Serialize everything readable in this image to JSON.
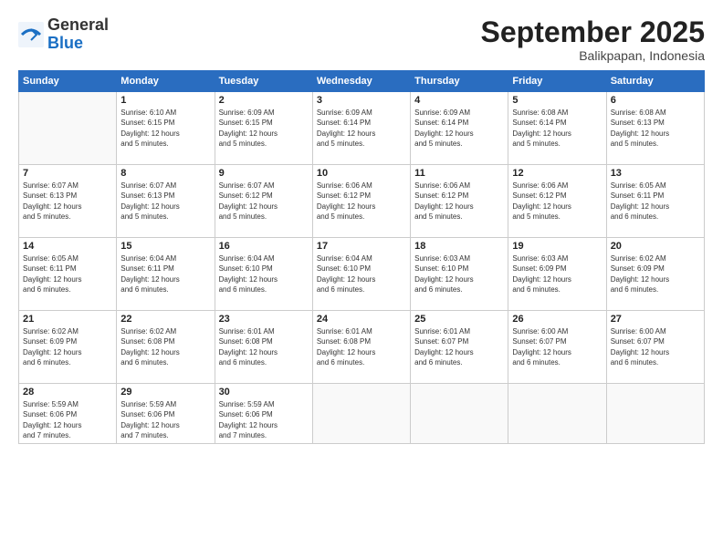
{
  "logo": {
    "general": "General",
    "blue": "Blue"
  },
  "title": "September 2025",
  "subtitle": "Balikpapan, Indonesia",
  "headers": [
    "Sunday",
    "Monday",
    "Tuesday",
    "Wednesday",
    "Thursday",
    "Friday",
    "Saturday"
  ],
  "weeks": [
    [
      {
        "day": "",
        "info": ""
      },
      {
        "day": "1",
        "info": "Sunrise: 6:10 AM\nSunset: 6:15 PM\nDaylight: 12 hours\nand 5 minutes."
      },
      {
        "day": "2",
        "info": "Sunrise: 6:09 AM\nSunset: 6:15 PM\nDaylight: 12 hours\nand 5 minutes."
      },
      {
        "day": "3",
        "info": "Sunrise: 6:09 AM\nSunset: 6:14 PM\nDaylight: 12 hours\nand 5 minutes."
      },
      {
        "day": "4",
        "info": "Sunrise: 6:09 AM\nSunset: 6:14 PM\nDaylight: 12 hours\nand 5 minutes."
      },
      {
        "day": "5",
        "info": "Sunrise: 6:08 AM\nSunset: 6:14 PM\nDaylight: 12 hours\nand 5 minutes."
      },
      {
        "day": "6",
        "info": "Sunrise: 6:08 AM\nSunset: 6:13 PM\nDaylight: 12 hours\nand 5 minutes."
      }
    ],
    [
      {
        "day": "7",
        "info": "Sunrise: 6:07 AM\nSunset: 6:13 PM\nDaylight: 12 hours\nand 5 minutes."
      },
      {
        "day": "8",
        "info": "Sunrise: 6:07 AM\nSunset: 6:13 PM\nDaylight: 12 hours\nand 5 minutes."
      },
      {
        "day": "9",
        "info": "Sunrise: 6:07 AM\nSunset: 6:12 PM\nDaylight: 12 hours\nand 5 minutes."
      },
      {
        "day": "10",
        "info": "Sunrise: 6:06 AM\nSunset: 6:12 PM\nDaylight: 12 hours\nand 5 minutes."
      },
      {
        "day": "11",
        "info": "Sunrise: 6:06 AM\nSunset: 6:12 PM\nDaylight: 12 hours\nand 5 minutes."
      },
      {
        "day": "12",
        "info": "Sunrise: 6:06 AM\nSunset: 6:12 PM\nDaylight: 12 hours\nand 5 minutes."
      },
      {
        "day": "13",
        "info": "Sunrise: 6:05 AM\nSunset: 6:11 PM\nDaylight: 12 hours\nand 6 minutes."
      }
    ],
    [
      {
        "day": "14",
        "info": "Sunrise: 6:05 AM\nSunset: 6:11 PM\nDaylight: 12 hours\nand 6 minutes."
      },
      {
        "day": "15",
        "info": "Sunrise: 6:04 AM\nSunset: 6:11 PM\nDaylight: 12 hours\nand 6 minutes."
      },
      {
        "day": "16",
        "info": "Sunrise: 6:04 AM\nSunset: 6:10 PM\nDaylight: 12 hours\nand 6 minutes."
      },
      {
        "day": "17",
        "info": "Sunrise: 6:04 AM\nSunset: 6:10 PM\nDaylight: 12 hours\nand 6 minutes."
      },
      {
        "day": "18",
        "info": "Sunrise: 6:03 AM\nSunset: 6:10 PM\nDaylight: 12 hours\nand 6 minutes."
      },
      {
        "day": "19",
        "info": "Sunrise: 6:03 AM\nSunset: 6:09 PM\nDaylight: 12 hours\nand 6 minutes."
      },
      {
        "day": "20",
        "info": "Sunrise: 6:02 AM\nSunset: 6:09 PM\nDaylight: 12 hours\nand 6 minutes."
      }
    ],
    [
      {
        "day": "21",
        "info": "Sunrise: 6:02 AM\nSunset: 6:09 PM\nDaylight: 12 hours\nand 6 minutes."
      },
      {
        "day": "22",
        "info": "Sunrise: 6:02 AM\nSunset: 6:08 PM\nDaylight: 12 hours\nand 6 minutes."
      },
      {
        "day": "23",
        "info": "Sunrise: 6:01 AM\nSunset: 6:08 PM\nDaylight: 12 hours\nand 6 minutes."
      },
      {
        "day": "24",
        "info": "Sunrise: 6:01 AM\nSunset: 6:08 PM\nDaylight: 12 hours\nand 6 minutes."
      },
      {
        "day": "25",
        "info": "Sunrise: 6:01 AM\nSunset: 6:07 PM\nDaylight: 12 hours\nand 6 minutes."
      },
      {
        "day": "26",
        "info": "Sunrise: 6:00 AM\nSunset: 6:07 PM\nDaylight: 12 hours\nand 6 minutes."
      },
      {
        "day": "27",
        "info": "Sunrise: 6:00 AM\nSunset: 6:07 PM\nDaylight: 12 hours\nand 6 minutes."
      }
    ],
    [
      {
        "day": "28",
        "info": "Sunrise: 5:59 AM\nSunset: 6:06 PM\nDaylight: 12 hours\nand 7 minutes."
      },
      {
        "day": "29",
        "info": "Sunrise: 5:59 AM\nSunset: 6:06 PM\nDaylight: 12 hours\nand 7 minutes."
      },
      {
        "day": "30",
        "info": "Sunrise: 5:59 AM\nSunset: 6:06 PM\nDaylight: 12 hours\nand 7 minutes."
      },
      {
        "day": "",
        "info": ""
      },
      {
        "day": "",
        "info": ""
      },
      {
        "day": "",
        "info": ""
      },
      {
        "day": "",
        "info": ""
      }
    ]
  ]
}
